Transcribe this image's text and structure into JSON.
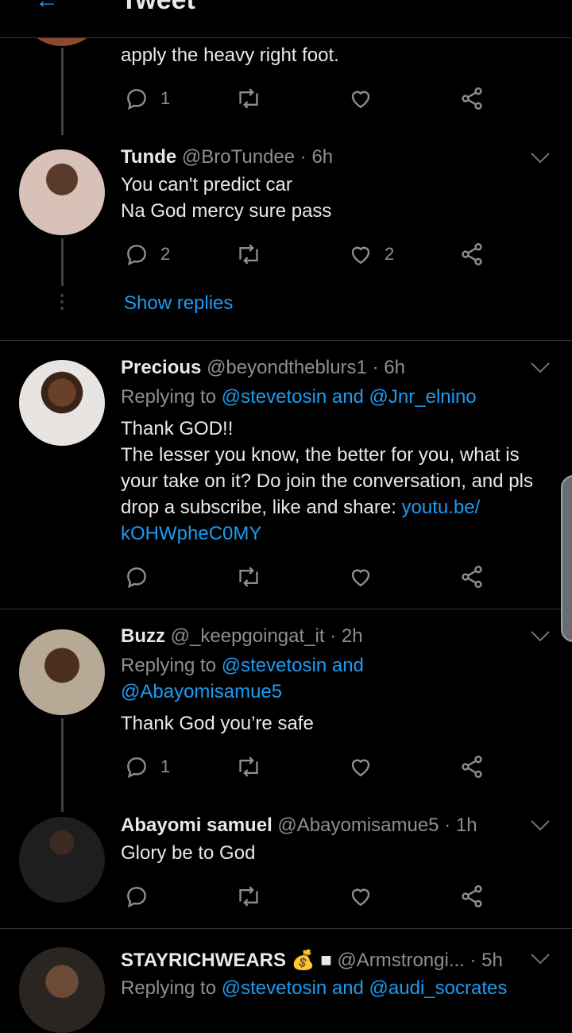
{
  "header": {
    "back_icon": "arrow-left-icon",
    "title": "Tweet"
  },
  "tweets": [
    {
      "text_tail": "apply  the heavy right foot.",
      "actions": {
        "reply_count": "1",
        "retweet_count": "",
        "like_count": ""
      }
    },
    {
      "name": "Tunde",
      "handle": "@BroTundee",
      "time": "· 6h",
      "text": [
        "You can't predict car",
        "Na God mercy sure pass"
      ],
      "actions": {
        "reply_count": "2",
        "retweet_count": "",
        "like_count": "2"
      },
      "show_replies": "Show replies"
    },
    {
      "name": "Precious",
      "handle": "@beyondtheblurs1",
      "time": "· 6h",
      "replying_label": "Replying to",
      "replying_to": "@stevetosin and @Jnr_elnino",
      "text_lines": [
        "Thank GOD!!",
        "The lesser you know, the better for you, what is",
        "your take on it? Do join the conversation, and pls",
        "drop a subscribe, like and share: "
      ],
      "link_1": "youtu.be/",
      "link_2": "kOHWpheC0MY",
      "actions": {
        "reply_count": "",
        "retweet_count": "",
        "like_count": ""
      }
    },
    {
      "name": "Buzz",
      "handle": "@_keepgoingat_it",
      "time": "· 2h",
      "replying_label": "Replying to",
      "replying_to_1": "@stevetosin and",
      "replying_to_2": "@Abayomisamue5",
      "text": "Thank God you’re safe",
      "actions": {
        "reply_count": "1",
        "retweet_count": "",
        "like_count": ""
      }
    },
    {
      "name": "Abayomi samuel",
      "handle": "@Abayomisamue5",
      "time": "· 1h",
      "text": "Glory be to God",
      "actions": {
        "reply_count": "",
        "retweet_count": "",
        "like_count": ""
      }
    },
    {
      "name": "STAYRICHWEARS",
      "emoji": "💰",
      "square": "■",
      "handle": "@Armstrongi...",
      "time": "· 5h",
      "replying_label": "Replying to",
      "replying_to": "@stevetosin and @audi_socrates"
    }
  ],
  "colors": {
    "background": "#000000",
    "accent": "#1d9bf0",
    "muted": "#8b8f94",
    "text": "#e7e9ea",
    "divider": "#2f3336"
  }
}
